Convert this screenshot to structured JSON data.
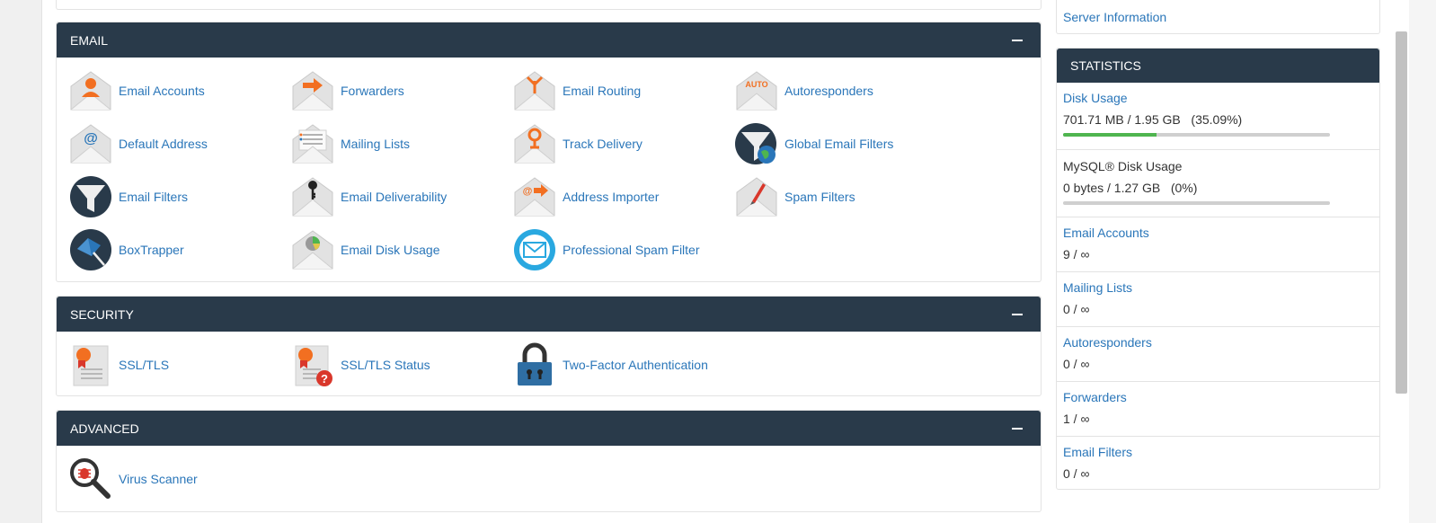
{
  "colors": {
    "header_bg": "#293a4a",
    "link": "#2a76b9",
    "progress_fill": "#4fb54f",
    "progress_track": "#cfcfcf"
  },
  "sidebar_top": {
    "link": "Server Information"
  },
  "email": {
    "title": "EMAIL",
    "items": [
      {
        "label": "Email Accounts",
        "icon": "email-accounts-icon"
      },
      {
        "label": "Forwarders",
        "icon": "forwarders-icon"
      },
      {
        "label": "Email Routing",
        "icon": "email-routing-icon"
      },
      {
        "label": "Autoresponders",
        "icon": "autoresponders-icon",
        "icon_text": "AUTO"
      },
      {
        "label": "Default Address",
        "icon": "default-address-icon"
      },
      {
        "label": "Mailing Lists",
        "icon": "mailing-lists-icon"
      },
      {
        "label": "Track Delivery",
        "icon": "track-delivery-icon"
      },
      {
        "label": "Global Email Filters",
        "icon": "global-email-filters-icon"
      },
      {
        "label": "Email Filters",
        "icon": "email-filters-icon"
      },
      {
        "label": "Email Deliverability",
        "icon": "email-deliverability-icon"
      },
      {
        "label": "Address Importer",
        "icon": "address-importer-icon"
      },
      {
        "label": "Spam Filters",
        "icon": "spam-filters-icon"
      },
      {
        "label": "BoxTrapper",
        "icon": "boxtrapper-icon"
      },
      {
        "label": "Email Disk Usage",
        "icon": "email-disk-usage-icon"
      },
      {
        "label": "Professional Spam Filter",
        "icon": "professional-spam-filter-icon"
      }
    ]
  },
  "security": {
    "title": "SECURITY",
    "items": [
      {
        "label": "SSL/TLS",
        "icon": "ssl-tls-icon"
      },
      {
        "label": "SSL/TLS Status",
        "icon": "ssl-tls-status-icon"
      },
      {
        "label": "Two-Factor Authentication",
        "icon": "padlock-icon"
      }
    ]
  },
  "advanced": {
    "title": "ADVANCED",
    "items": [
      {
        "label": "Virus Scanner",
        "icon": "virus-scanner-icon"
      }
    ]
  },
  "statistics": {
    "title": "STATISTICS",
    "rows": [
      {
        "title": "Disk Usage",
        "value": "701.71 MB / 1.95 GB   (35.09%)",
        "progress": 0.3509
      },
      {
        "title": "MySQL® Disk Usage",
        "value": "0 bytes / 1.27 GB   (0%)",
        "progress": 0
      },
      {
        "title": "Email Accounts",
        "value": "9 / ∞"
      },
      {
        "title": "Mailing Lists",
        "value": "0 / ∞"
      },
      {
        "title": "Autoresponders",
        "value": "0 / ∞"
      },
      {
        "title": "Forwarders",
        "value": "1 / ∞"
      },
      {
        "title": "Email Filters",
        "value": "0 / ∞"
      }
    ]
  }
}
